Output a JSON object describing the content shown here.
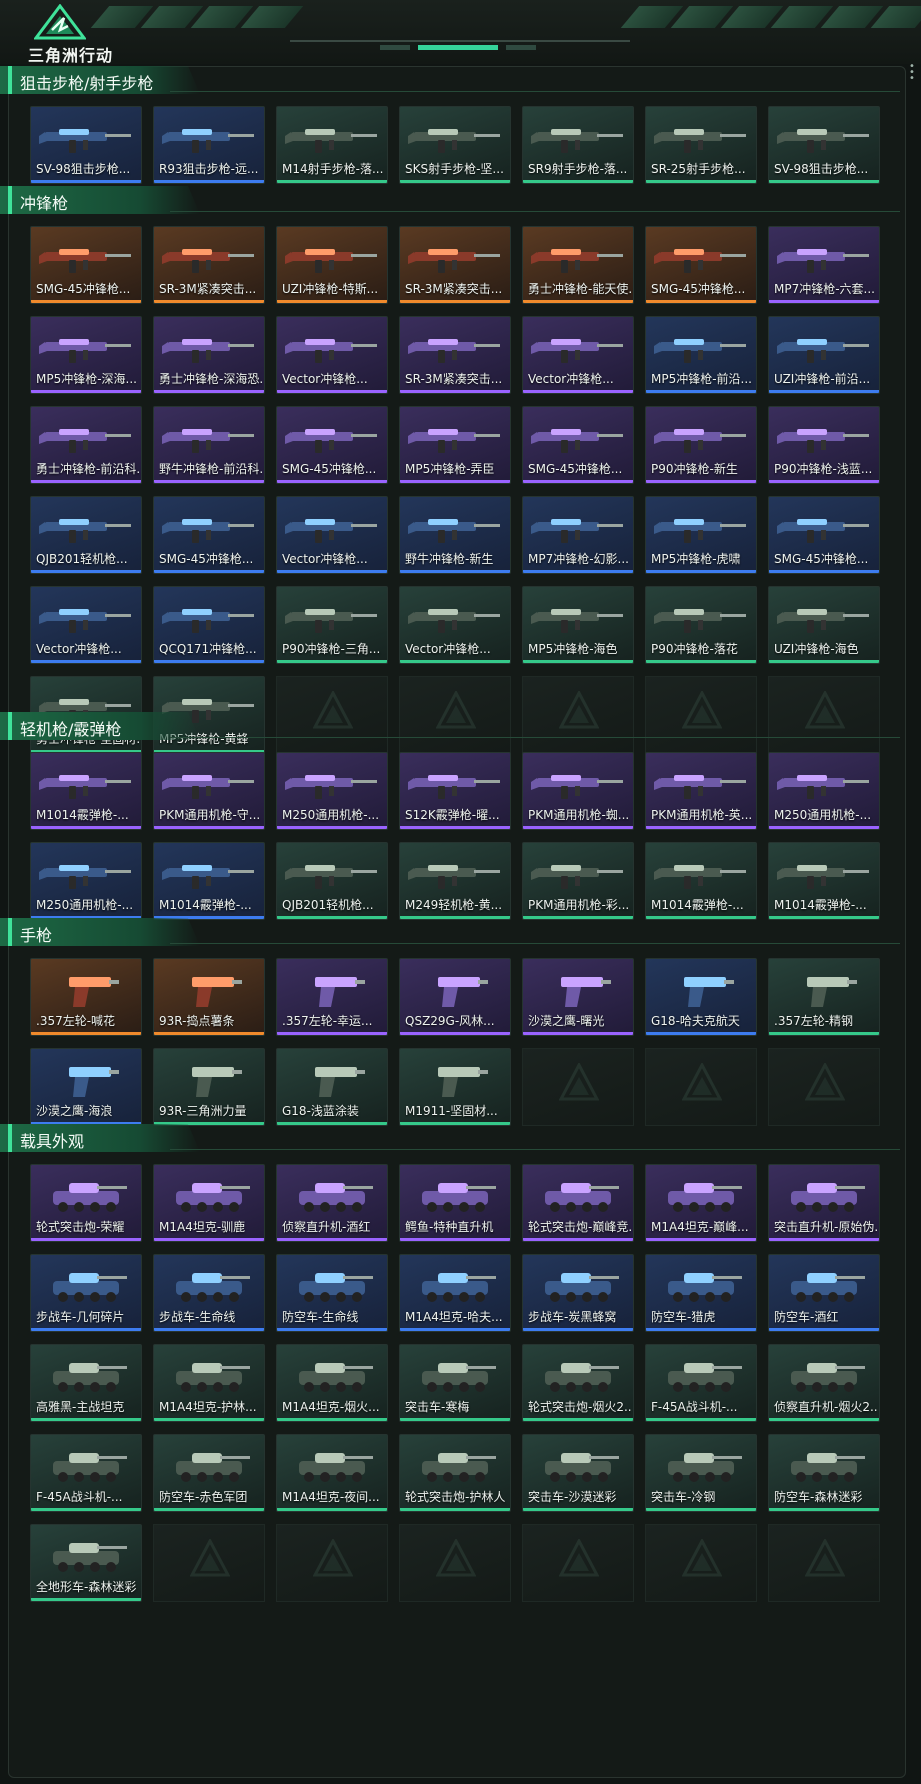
{
  "header": {
    "brand": "三角洲行动"
  },
  "colors": {
    "purple": "#9a63ff",
    "blue": "#3d7cf0",
    "orange": "#f08a2c",
    "green": "#35c98a",
    "accent": "#3fe39a"
  },
  "sections": [
    {
      "title": "狙击步枪/射手步枪",
      "kind": "gun",
      "empty": 0,
      "items": [
        {
          "name": "SV-98狙击步枪...",
          "rarity": "blue"
        },
        {
          "name": "R93狙击步枪-远...",
          "rarity": "blue"
        },
        {
          "name": "M14射手步枪-落...",
          "rarity": "green"
        },
        {
          "name": "SKS射手步枪-坚...",
          "rarity": "green"
        },
        {
          "name": "SR9射手步枪-落...",
          "rarity": "green"
        },
        {
          "name": "SR-25射手步枪...",
          "rarity": "green"
        },
        {
          "name": "SV-98狙击步枪...",
          "rarity": "green"
        }
      ]
    },
    {
      "title": "冲锋枪",
      "kind": "gun",
      "empty": 5,
      "items": [
        {
          "name": "SMG-45冲锋枪...",
          "rarity": "orange"
        },
        {
          "name": "SR-3M紧凑突击...",
          "rarity": "orange"
        },
        {
          "name": "UZI冲锋枪-特斯...",
          "rarity": "orange"
        },
        {
          "name": "SR-3M紧凑突击...",
          "rarity": "orange"
        },
        {
          "name": "勇士冲锋枪-能天使...",
          "rarity": "orange"
        },
        {
          "name": "SMG-45冲锋枪...",
          "rarity": "orange"
        },
        {
          "name": "MP7冲锋枪-六套...",
          "rarity": "purple"
        },
        {
          "name": "MP5冲锋枪-深海...",
          "rarity": "purple"
        },
        {
          "name": "勇士冲锋枪-深海恐...",
          "rarity": "purple"
        },
        {
          "name": "Vector冲锋枪...",
          "rarity": "purple"
        },
        {
          "name": "SR-3M紧凑突击...",
          "rarity": "purple"
        },
        {
          "name": "Vector冲锋枪...",
          "rarity": "purple"
        },
        {
          "name": "MP5冲锋枪-前沿...",
          "rarity": "blue"
        },
        {
          "name": "UZI冲锋枪-前沿...",
          "rarity": "blue"
        },
        {
          "name": "勇士冲锋枪-前沿科...",
          "rarity": "purple"
        },
        {
          "name": "野牛冲锋枪-前沿科...",
          "rarity": "purple"
        },
        {
          "name": "SMG-45冲锋枪...",
          "rarity": "purple"
        },
        {
          "name": "MP5冲锋枪-弄臣",
          "rarity": "purple"
        },
        {
          "name": "SMG-45冲锋枪...",
          "rarity": "purple"
        },
        {
          "name": "P90冲锋枪-新生",
          "rarity": "purple"
        },
        {
          "name": "P90冲锋枪-浅蓝...",
          "rarity": "purple"
        },
        {
          "name": "QJB201轻机枪...",
          "rarity": "blue"
        },
        {
          "name": "SMG-45冲锋枪...",
          "rarity": "blue"
        },
        {
          "name": "Vector冲锋枪...",
          "rarity": "blue"
        },
        {
          "name": "野牛冲锋枪-新生",
          "rarity": "blue"
        },
        {
          "name": "MP7冲锋枪-幻影...",
          "rarity": "blue"
        },
        {
          "name": "MP5冲锋枪-虎啸",
          "rarity": "blue"
        },
        {
          "name": "SMG-45冲锋枪...",
          "rarity": "blue"
        },
        {
          "name": "Vector冲锋枪...",
          "rarity": "blue"
        },
        {
          "name": "QCQ171冲锋枪...",
          "rarity": "blue"
        },
        {
          "name": "P90冲锋枪-三角...",
          "rarity": "green"
        },
        {
          "name": "Vector冲锋枪...",
          "rarity": "green"
        },
        {
          "name": "MP5冲锋枪-海色",
          "rarity": "green"
        },
        {
          "name": "P90冲锋枪-落花",
          "rarity": "green"
        },
        {
          "name": "UZI冲锋枪-海色",
          "rarity": "green"
        },
        {
          "name": "勇士冲锋枪-坚固材...",
          "rarity": "green"
        },
        {
          "name": "MP5冲锋枪-黄蜂",
          "rarity": "green"
        }
      ]
    },
    {
      "title": "轻机枪/霰弹枪",
      "kind": "gun",
      "empty": 0,
      "items": [
        {
          "name": "M1014霰弹枪-...",
          "rarity": "purple"
        },
        {
          "name": "PKM通用机枪-守...",
          "rarity": "purple"
        },
        {
          "name": "M250通用机枪-...",
          "rarity": "purple"
        },
        {
          "name": "S12K霰弹枪-曜...",
          "rarity": "purple"
        },
        {
          "name": "PKM通用机枪-蜘...",
          "rarity": "purple"
        },
        {
          "name": "PKM通用机枪-英...",
          "rarity": "purple"
        },
        {
          "name": "M250通用机枪-...",
          "rarity": "purple"
        },
        {
          "name": "M250通用机枪-...",
          "rarity": "blue"
        },
        {
          "name": "M1014霰弹枪-...",
          "rarity": "blue"
        },
        {
          "name": "QJB201轻机枪...",
          "rarity": "green"
        },
        {
          "name": "M249轻机枪-黄...",
          "rarity": "green"
        },
        {
          "name": "PKM通用机枪-彩...",
          "rarity": "green"
        },
        {
          "name": "M1014霰弹枪-...",
          "rarity": "green"
        },
        {
          "name": "M1014霰弹枪-...",
          "rarity": "green"
        }
      ]
    },
    {
      "title": "手枪",
      "kind": "pistol",
      "empty": 3,
      "items": [
        {
          "name": ".357左轮-喊花",
          "rarity": "orange"
        },
        {
          "name": "93R-捣点薯条",
          "rarity": "orange"
        },
        {
          "name": ".357左轮-幸运...",
          "rarity": "purple"
        },
        {
          "name": "QSZ29G-风林...",
          "rarity": "purple"
        },
        {
          "name": "沙漠之鹰-曙光",
          "rarity": "purple"
        },
        {
          "name": "G18-哈夫克航天",
          "rarity": "blue"
        },
        {
          "name": ".357左轮-精钢",
          "rarity": "green"
        },
        {
          "name": "沙漠之鹰-海浪",
          "rarity": "blue"
        },
        {
          "name": "93R-三角洲力量",
          "rarity": "green"
        },
        {
          "name": "G18-浅蓝涂装",
          "rarity": "green"
        },
        {
          "name": "M1911-坚固材...",
          "rarity": "green"
        }
      ]
    },
    {
      "title": "载具外观",
      "kind": "vehicle",
      "empty": 6,
      "items": [
        {
          "name": "轮式突击炮-荣耀",
          "rarity": "purple"
        },
        {
          "name": "M1A4坦克-驯鹿",
          "rarity": "purple"
        },
        {
          "name": "侦察直升机-酒红",
          "rarity": "purple"
        },
        {
          "name": "鳄鱼-特种直升机",
          "rarity": "purple"
        },
        {
          "name": "轮式突击炮-巅峰竞...",
          "rarity": "purple"
        },
        {
          "name": "M1A4坦克-巅峰...",
          "rarity": "purple"
        },
        {
          "name": "突击直升机-原始伪...",
          "rarity": "purple"
        },
        {
          "name": "步战车-几何碎片",
          "rarity": "blue"
        },
        {
          "name": "步战车-生命线",
          "rarity": "blue"
        },
        {
          "name": "防空车-生命线",
          "rarity": "blue"
        },
        {
          "name": "M1A4坦克-哈夫...",
          "rarity": "blue"
        },
        {
          "name": "步战车-炭黑蜂窝",
          "rarity": "blue"
        },
        {
          "name": "防空车-猎虎",
          "rarity": "blue"
        },
        {
          "name": "防空车-酒红",
          "rarity": "blue"
        },
        {
          "name": "高雅黑-主战坦克",
          "rarity": "green"
        },
        {
          "name": "M1A4坦克-护林...",
          "rarity": "green"
        },
        {
          "name": "M1A4坦克-烟火...",
          "rarity": "green"
        },
        {
          "name": "突击车-寒梅",
          "rarity": "green"
        },
        {
          "name": "轮式突击炮-烟火2...",
          "rarity": "green"
        },
        {
          "name": "F-45A战斗机-...",
          "rarity": "green"
        },
        {
          "name": "侦察直升机-烟火2...",
          "rarity": "green"
        },
        {
          "name": "F-45A战斗机-...",
          "rarity": "green"
        },
        {
          "name": "防空车-赤色军团",
          "rarity": "green"
        },
        {
          "name": "M1A4坦克-夜间...",
          "rarity": "green"
        },
        {
          "name": "轮式突击炮-护林人",
          "rarity": "green"
        },
        {
          "name": "突击车-沙漠迷彩",
          "rarity": "green"
        },
        {
          "name": "突击车-冷钢",
          "rarity": "green"
        },
        {
          "name": "防空车-森林迷彩",
          "rarity": "green"
        },
        {
          "name": "全地形车-森林迷彩",
          "rarity": "green"
        }
      ]
    }
  ]
}
